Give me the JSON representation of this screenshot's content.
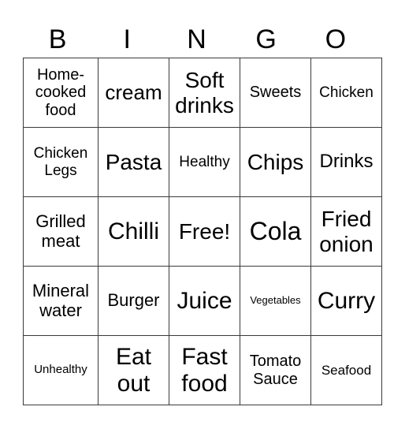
{
  "header": {
    "letters": [
      "B",
      "I",
      "N",
      "G",
      "O"
    ]
  },
  "grid": [
    [
      "Home-cooked food",
      "cream",
      "Soft drinks",
      "Sweets",
      "Chicken"
    ],
    [
      "Chicken Legs",
      "Pasta",
      "Healthy",
      "Chips",
      "Drinks"
    ],
    [
      "Grilled meat",
      "Chilli",
      "Free!",
      "Cola",
      "Fried onion"
    ],
    [
      "Mineral water",
      "Burger",
      "Juice",
      "Vegetables",
      "Curry"
    ],
    [
      "Unhealthy",
      "Eat out",
      "Fast food",
      "Tomato Sauce",
      "Seafood"
    ]
  ],
  "colors": {
    "grid_line": "#3a3a3a",
    "text": "#000000",
    "background": "#ffffff"
  }
}
